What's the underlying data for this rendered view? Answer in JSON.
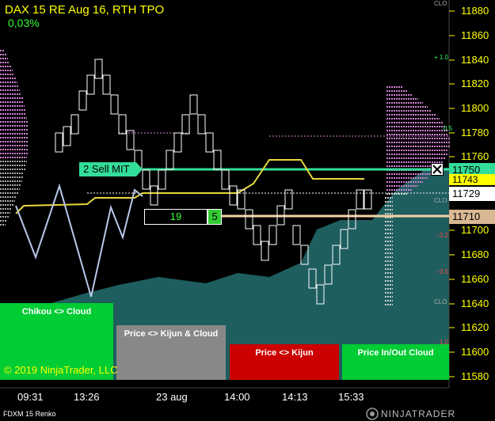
{
  "header": {
    "title": "DAX 15 RE  Aug 16, RTH TPO",
    "change": "0,03%"
  },
  "y_axis": {
    "labels": [
      "11880",
      "11860",
      "11840",
      "11820",
      "11800",
      "11780",
      "11760",
      "11700",
      "11680",
      "11660",
      "11640",
      "11620",
      "11600",
      "11580"
    ]
  },
  "x_axis": {
    "labels": [
      "09:31",
      "13:26",
      "23 aug",
      "14:00",
      "14:13",
      "15:33"
    ]
  },
  "price_markers": {
    "current_1": "11750",
    "current_2": "11743",
    "last": "11729",
    "order": "11710"
  },
  "order_line": {
    "label": "2  Sell MIT"
  },
  "position": {
    "qty": "19",
    "count": "5"
  },
  "side_labels": {
    "clo_top": "CLO",
    "plus_1": "+ 1.0",
    "plus_half": "0.5",
    "clo_mid": "CLO",
    "minus_02": "- 0.2",
    "minus_05": "- 0.5",
    "clo_bottom": "CLO",
    "minus_1": "- 1.0"
  },
  "panels": {
    "chikou": "Chikou <> Cloud",
    "kijun_cloud": "Price <> Kijun & Cloud",
    "kijun": "Price <> Kijun",
    "inout": "Price In/Out Cloud"
  },
  "footer": {
    "copyright": "© 2019 NinjaTrader, LLC",
    "instrument": "FDXM 15 Renko",
    "brand": "NINJATRADER"
  },
  "colors": {
    "background": "#000000",
    "axis_text": "#ffff00",
    "cloud": "#1e5e5e",
    "order_line": "#33dd99",
    "position_line": "#f5d2a8",
    "kijun": "#e8d83a",
    "chikou": "#b8c8e8",
    "tpo": "#d080d0",
    "panel_green": "#00cc33",
    "panel_gray": "#888888",
    "panel_red": "#cc0000"
  }
}
